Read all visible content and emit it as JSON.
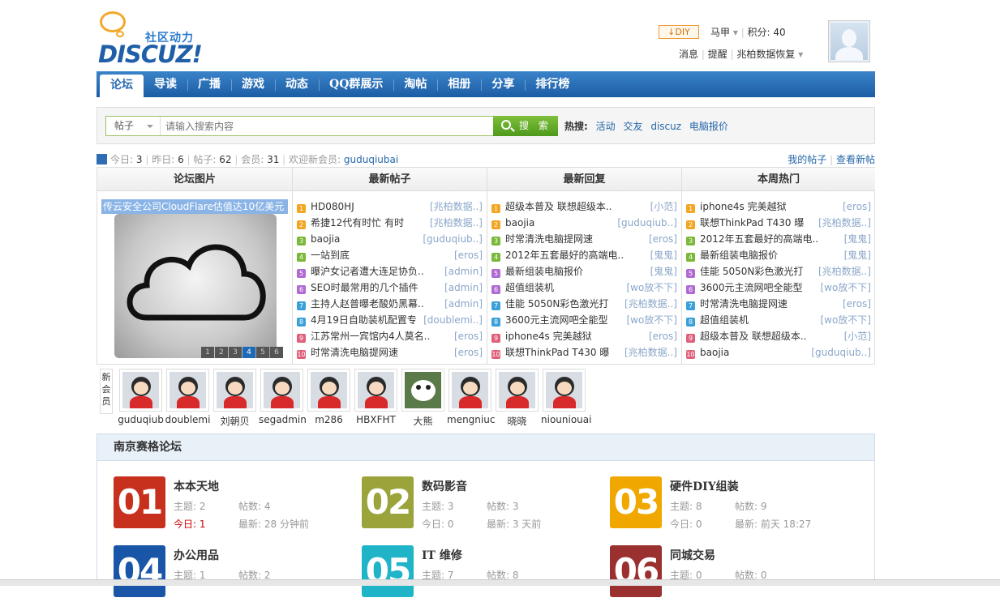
{
  "logo": {
    "cn": "社区动力",
    "en": "DISCUZ!"
  },
  "user": {
    "diy": "DIY",
    "name": "马甲",
    "points": "积分: 40",
    "links": [
      "消息",
      "提醒",
      "兆柏数据恢复"
    ]
  },
  "nav": [
    "论坛",
    "导读",
    "广播",
    "游戏",
    "动态",
    "QQ群展示",
    "淘帖",
    "相册",
    "分享",
    "排行榜"
  ],
  "search": {
    "type": "帖子",
    "placeholder": "请输入搜索内容",
    "button": "搜 索",
    "hot_label": "热搜:",
    "hot": [
      "活动",
      "交友",
      "discuz",
      "电脑报价"
    ]
  },
  "stats": {
    "today_label": "今日:",
    "today": "3",
    "yest_label": "昨日:",
    "yest": "6",
    "posts_label": "帖子:",
    "posts": "62",
    "members_label": "会员:",
    "members": "31",
    "welcome": "欢迎新会员:",
    "newuser": "guduqiubai",
    "my": "我的帖子",
    "newposts": "查看新帖"
  },
  "cols": {
    "pics": "论坛图片",
    "new": "最新帖子",
    "reply": "最新回复",
    "hot": "本周热门"
  },
  "pic": {
    "caption": "传云安全公司CloudFlare估值达10亿美元",
    "pages": [
      "1",
      "2",
      "3",
      "4",
      "5",
      "6"
    ]
  },
  "newposts": [
    {
      "t": "HD080HJ",
      "a": "[兆柏数据..]"
    },
    {
      "t": "希捷12代有时忙 有时",
      "a": "[兆柏数据..]"
    },
    {
      "t": "baojia",
      "a": "[guduqiub..]"
    },
    {
      "t": "一站到底",
      "a": "[eros]"
    },
    {
      "t": "曝沪女记者遭大连足协负..",
      "a": "[admin]"
    },
    {
      "t": "SEO时最常用的几个插件",
      "a": "[admin]"
    },
    {
      "t": "主持人赵普曝老酸奶黑幕..",
      "a": "[admin]"
    },
    {
      "t": "4月19日自助装机配置专",
      "a": "[doublemi..]"
    },
    {
      "t": "江苏常州一宾馆内4人莫名..",
      "a": "[eros]"
    },
    {
      "t": "时常清洗电脑提网速",
      "a": "[eros]"
    }
  ],
  "replies": [
    {
      "t": "超级本普及 联想超级本..",
      "a": "[小范]"
    },
    {
      "t": "baojia",
      "a": "[guduqiub..]"
    },
    {
      "t": "时常清洗电脑提网速",
      "a": "[eros]"
    },
    {
      "t": "2012年五套最好的高端电..",
      "a": "[鬼鬼]"
    },
    {
      "t": "最新组装电脑报价",
      "a": "[鬼鬼]"
    },
    {
      "t": "超值组装机",
      "a": "[wo放不下]"
    },
    {
      "t": "佳能 5050N彩色激光打",
      "a": "[兆柏数据..]"
    },
    {
      "t": "3600元主流网吧全能型",
      "a": "[wo放不下]"
    },
    {
      "t": "iphone4s 完美越狱",
      "a": "[eros]"
    },
    {
      "t": "联想ThinkPad T430 曝",
      "a": "[兆柏数据..]"
    }
  ],
  "hotlist": [
    {
      "t": "iphone4s 完美越狱",
      "a": "[eros]"
    },
    {
      "t": "联想ThinkPad T430 曝",
      "a": "[兆柏数据..]"
    },
    {
      "t": "2012年五套最好的高端电..",
      "a": "[鬼鬼]"
    },
    {
      "t": "最新组装电脑报价",
      "a": "[鬼鬼]"
    },
    {
      "t": "佳能 5050N彩色激光打",
      "a": "[兆柏数据..]"
    },
    {
      "t": "3600元主流网吧全能型",
      "a": "[wo放不下]"
    },
    {
      "t": "时常清洗电脑提网速",
      "a": "[eros]"
    },
    {
      "t": "超值组装机",
      "a": "[wo放不下]"
    },
    {
      "t": "超级本普及 联想超级本..",
      "a": "[小范]"
    },
    {
      "t": "baojia",
      "a": "[guduqiub..]"
    }
  ],
  "members_label": "新会员",
  "members": [
    "guduqiub",
    "doublemi",
    "刘朝贝",
    "segadmin",
    "m286",
    "HBXFHT",
    "大熊",
    "mengniuc",
    "晓晓",
    "niouniouai"
  ],
  "forum_title": "南京赛格论坛",
  "forums": [
    {
      "num": "01",
      "name": "本本天地",
      "color": "#c8301e",
      "topics": "主题: 2",
      "posts": "帖数: 4",
      "today": "今日: 1",
      "last": "最新: 28 分钟前"
    },
    {
      "num": "02",
      "name": "数码影音",
      "color": "#9aa43a",
      "topics": "主题: 3",
      "posts": "帖数: 3",
      "today": "今日: 0",
      "last": "最新: 3 天前"
    },
    {
      "num": "03",
      "name": "硬件DIY组装",
      "color": "#f0a800",
      "topics": "主题: 8",
      "posts": "帖数: 9",
      "today": "今日: 0",
      "last": "最新: 前天 18:27"
    },
    {
      "num": "04",
      "name": "办公用品",
      "color": "#1a56a8",
      "topics": "主题: 1",
      "posts": "帖数: 2"
    },
    {
      "num": "05",
      "name": "IT 维修",
      "color": "#20b4c8",
      "topics": "主题: 7",
      "posts": "帖数: 8"
    },
    {
      "num": "06",
      "name": "同城交易",
      "color": "#9a3030",
      "topics": "主题: 0",
      "posts": "帖数: 0"
    }
  ]
}
